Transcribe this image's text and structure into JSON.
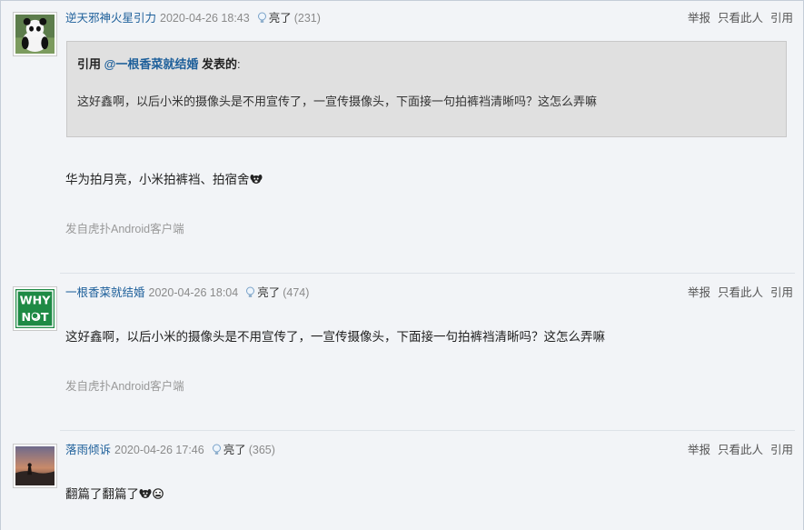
{
  "actions": {
    "report": "举报",
    "only_this": "只看此人",
    "quote": "引用"
  },
  "light_label": "亮了",
  "posts": [
    {
      "username": "逆天邪神火星引力",
      "time": "2020-04-26 18:43",
      "light_count": "(231)",
      "quote": {
        "prefix": "引用",
        "user": "@一根香菜就结婚",
        "suffix": "发表的",
        "colon": ":",
        "text": "这好鑫啊，以后小米的摄像头是不用宣传了，一宣传摄像头，下面接一句拍裤裆清晰吗？这怎么弄嘛"
      },
      "content": "华为拍月亮，小米拍裤裆、拍宿舍",
      "source": "发自虎扑Android客户端"
    },
    {
      "username": "一根香菜就结婚",
      "time": "2020-04-26 18:04",
      "light_count": "(474)",
      "avatar_text": [
        "WHY",
        "NOT"
      ],
      "content": "这好鑫啊，以后小米的摄像头是不用宣传了，一宣传摄像头，下面接一句拍裤裆清晰吗？这怎么弄嘛",
      "source": "发自虎扑Android客户端"
    },
    {
      "username": "落雨倾诉",
      "time": "2020-04-26 17:46",
      "light_count": "(365)",
      "content": "翻篇了翻篇了"
    }
  ],
  "colors": {
    "link": "#1d5f9a",
    "quote_bg": "#e0e0e0",
    "page_bg": "#f2f4f7",
    "avatar2_bg": "#1e8a45"
  }
}
